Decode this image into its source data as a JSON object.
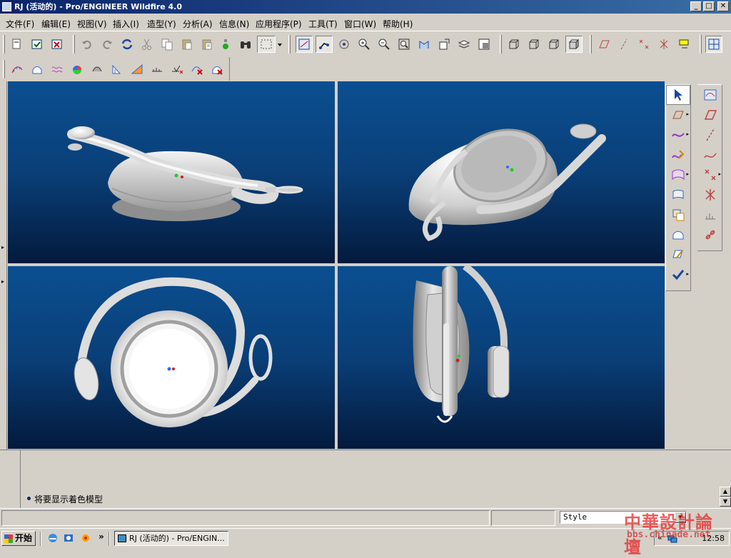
{
  "window": {
    "title": "RJ (活动的) - Pro/ENGINEER Wildfire 4.0",
    "minimize": "_",
    "restore": "□",
    "close": "✕"
  },
  "menu": [
    {
      "label": "文件(F)"
    },
    {
      "label": "编辑(E)"
    },
    {
      "label": "视图(V)"
    },
    {
      "label": "插入(I)"
    },
    {
      "label": "造型(Y)"
    },
    {
      "label": "分析(A)"
    },
    {
      "label": "信息(N)"
    },
    {
      "label": "应用程序(P)"
    },
    {
      "label": "工具(T)"
    },
    {
      "label": "窗口(W)"
    },
    {
      "label": "帮助(H)"
    }
  ],
  "viewports": [
    {
      "name": "front-view"
    },
    {
      "name": "isometric-view"
    },
    {
      "name": "top-view"
    },
    {
      "name": "side-view"
    }
  ],
  "message": {
    "text": "将要显示着色模型"
  },
  "status": {
    "style_label": "Style"
  },
  "taskbar": {
    "start_label": "开始",
    "quick_more": "»",
    "task_label": "RJ (活动的) - Pro/ENGIN...",
    "clock": "12:58"
  },
  "watermark": {
    "title": "中華設計論壇",
    "url": "bbs.chinade.net"
  },
  "colors": {
    "title_start": "#0a246a",
    "title_end": "#3a6ea5",
    "viewport_top": "#0b4f91",
    "viewport_bottom": "#031a3d",
    "model": "#e6e6e6"
  }
}
